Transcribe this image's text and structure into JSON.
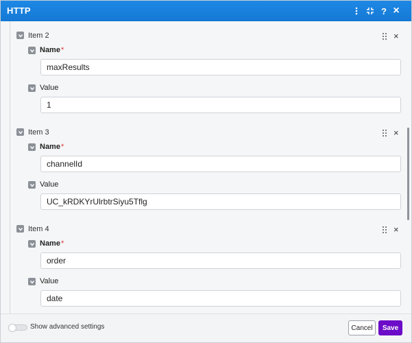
{
  "header": {
    "title": "HTTP",
    "icons": [
      "more-vertical-icon",
      "collapse-icon",
      "help-icon",
      "close-icon"
    ],
    "icon_glyphs": {
      "help": "?",
      "close": "×"
    },
    "background": "#1e88e5"
  },
  "items": [
    {
      "title": "Item 2",
      "name_label": "Name",
      "required_mark": "*",
      "name_value": "maxResults",
      "value_label": "Value",
      "value_value": "1"
    },
    {
      "title": "Item 3",
      "name_label": "Name",
      "required_mark": "*",
      "name_value": "channelId",
      "value_label": "Value",
      "value_value": "UC_kRDKYrUlrbtrSiyu5Tflg"
    },
    {
      "title": "Item 4",
      "name_label": "Name",
      "required_mark": "*",
      "name_value": "order",
      "value_label": "Value",
      "value_value": "date"
    }
  ],
  "item_controls": {
    "remove_glyph": "×"
  },
  "footer": {
    "advanced_label": "Show advanced settings",
    "advanced_enabled": false,
    "cancel_label": "Cancel",
    "save_label": "Save",
    "save_color": "#6b0cc8"
  }
}
